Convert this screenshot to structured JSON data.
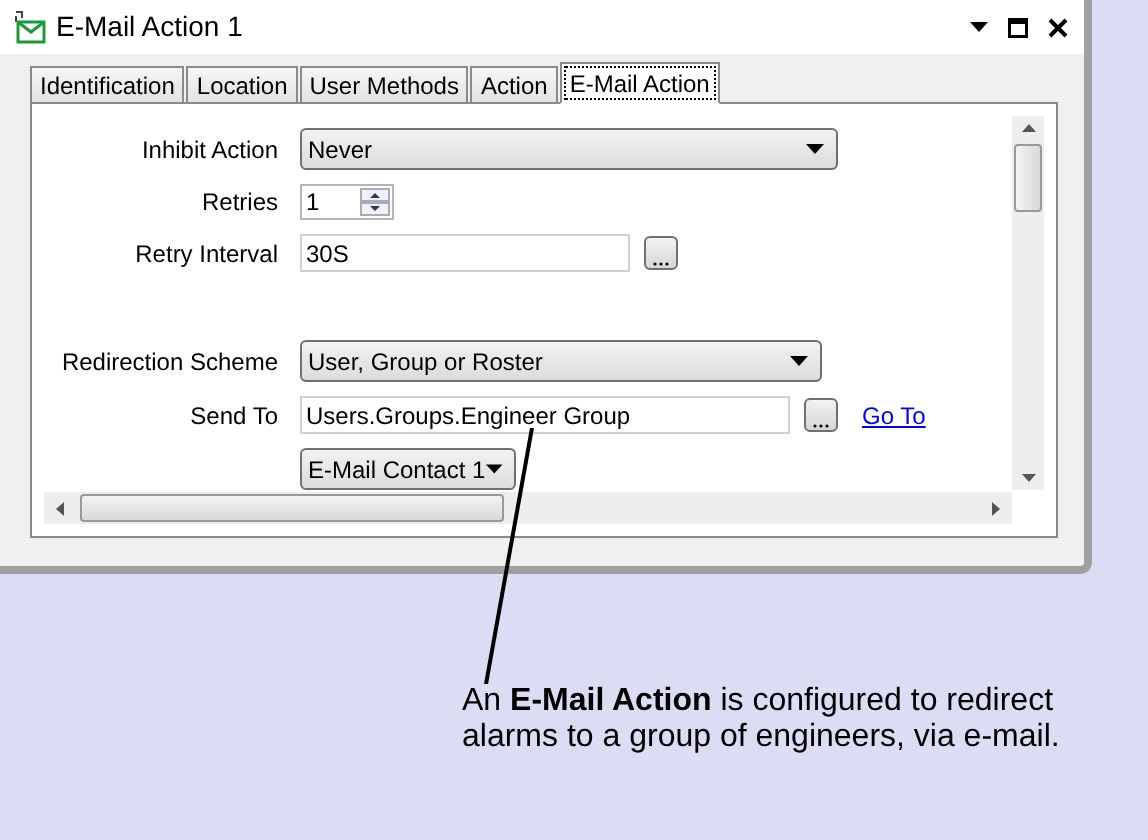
{
  "window": {
    "title": "E-Mail Action 1"
  },
  "tabs": [
    {
      "label": "Identification",
      "selected": false
    },
    {
      "label": "Location",
      "selected": false
    },
    {
      "label": "User Methods",
      "selected": false
    },
    {
      "label": "Action",
      "selected": false
    },
    {
      "label": "E-Mail Action",
      "selected": true
    }
  ],
  "form": [
    {
      "kind": "dropdown",
      "label": "Inhibit Action",
      "value": "Never"
    },
    {
      "kind": "spinner",
      "label": "Retries",
      "value": "1"
    },
    {
      "kind": "browse",
      "label": "Retry Interval",
      "value": "30S"
    },
    {
      "kind": "gap"
    },
    {
      "kind": "dropdown",
      "label": "Redirection Scheme",
      "value": "User, Group or Roster"
    },
    {
      "kind": "browse",
      "label": "Send To",
      "value": "Users.Groups.Engineer Group",
      "link": "Go To"
    },
    {
      "kind": "small-dropdown",
      "value": "E-Mail Contact 1"
    }
  ],
  "callout": "An **E-Mail Action** is configured to redirect alarms to a group of engineers, via e-mail."
}
